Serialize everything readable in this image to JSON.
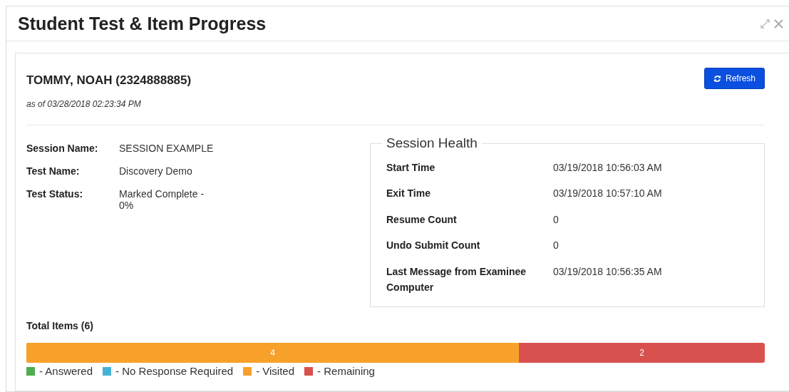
{
  "dialog": {
    "title": "Student Test & Item Progress"
  },
  "student": {
    "name": "TOMMY, NOAH (2324888885)",
    "as_of": "as of 03/28/2018 02:23:34 PM",
    "refresh_button": "Refresh"
  },
  "details": [
    {
      "label": "Session Name:",
      "value": "SESSION EXAMPLE"
    },
    {
      "label": "Test Name:",
      "value": "Discovery Demo"
    },
    {
      "label": "Test Status:",
      "value": "Marked Complete - 0%"
    }
  ],
  "session_health": {
    "title": "Session Health",
    "rows": [
      {
        "label": "Start Time",
        "value": "03/19/2018 10:56:03 AM"
      },
      {
        "label": "Exit Time",
        "value": "03/19/2018 10:57:10 AM"
      },
      {
        "label": "Resume Count",
        "value": "0"
      },
      {
        "label": "Undo Submit Count",
        "value": "0"
      },
      {
        "label": "Last Message from Examinee Computer",
        "value": "03/19/2018 10:56:35 AM"
      }
    ]
  },
  "total_items": {
    "title": "Total Items (6)",
    "level": 0.667,
    "filled_label": "4",
    "remaining_label": "2",
    "legend": [
      {
        "label": "- Answered",
        "color": "#4cae4c"
      },
      {
        "label": "- No Response Required",
        "color": "#46b1d6"
      },
      {
        "label": "- Visited",
        "color": "#f7a12a"
      },
      {
        "label": "- Remaining",
        "color": "#d9514e"
      }
    ]
  }
}
